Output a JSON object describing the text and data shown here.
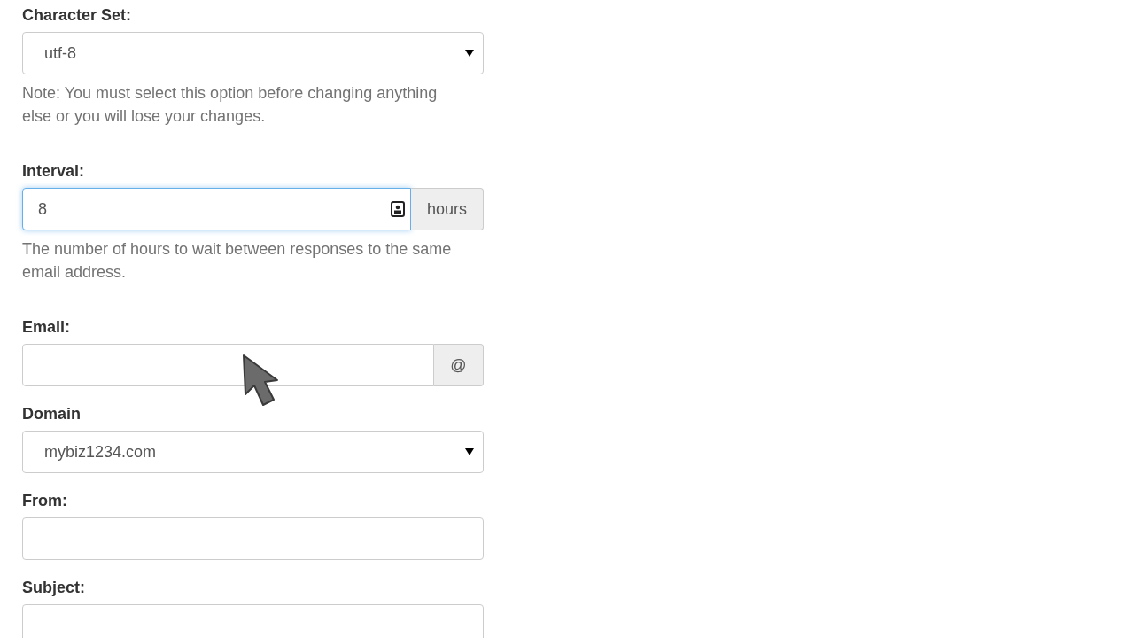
{
  "fields": [
    {
      "kind": "select",
      "label": "Character Set:",
      "value": "utf-8",
      "help": "Note: You must select this option before changing anything else or you will lose your changes.",
      "focused": false
    },
    {
      "kind": "addon",
      "label": "Interval:",
      "value": "8",
      "addon": "hours",
      "help": "The number of hours to wait between responses to the same email address.",
      "focused": true
    },
    {
      "kind": "addon",
      "label": "Email:",
      "addon": "@",
      "focused": false
    },
    {
      "kind": "select",
      "label": "Domain",
      "value": "mybiz1234.com",
      "focused": false
    },
    {
      "kind": "text",
      "label": "From:",
      "focused": false
    },
    {
      "kind": "text",
      "label": "Subject:",
      "focused": false
    }
  ]
}
